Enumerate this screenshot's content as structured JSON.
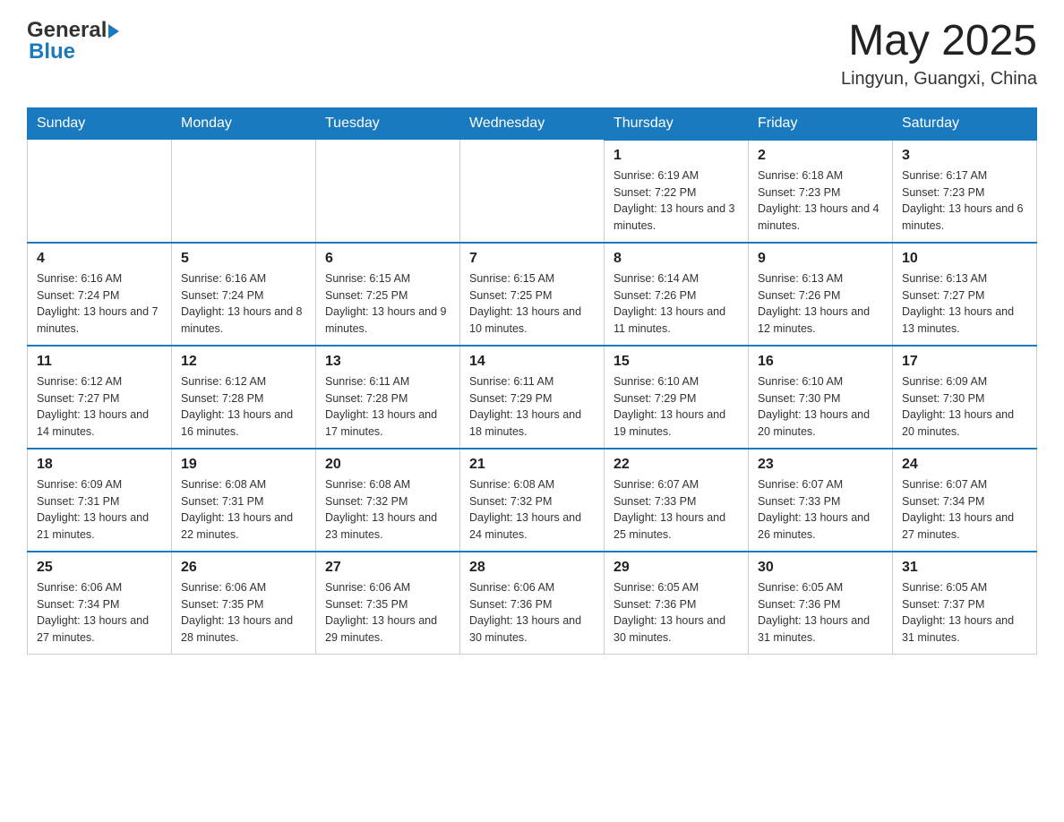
{
  "header": {
    "month_year": "May 2025",
    "location": "Lingyun, Guangxi, China"
  },
  "logo": {
    "general": "General",
    "blue": "Blue"
  },
  "days_of_week": [
    "Sunday",
    "Monday",
    "Tuesday",
    "Wednesday",
    "Thursday",
    "Friday",
    "Saturday"
  ],
  "weeks": [
    [
      {
        "day": "",
        "sunrise": "",
        "sunset": "",
        "daylight": ""
      },
      {
        "day": "",
        "sunrise": "",
        "sunset": "",
        "daylight": ""
      },
      {
        "day": "",
        "sunrise": "",
        "sunset": "",
        "daylight": ""
      },
      {
        "day": "",
        "sunrise": "",
        "sunset": "",
        "daylight": ""
      },
      {
        "day": "1",
        "sunrise": "Sunrise: 6:19 AM",
        "sunset": "Sunset: 7:22 PM",
        "daylight": "Daylight: 13 hours and 3 minutes."
      },
      {
        "day": "2",
        "sunrise": "Sunrise: 6:18 AM",
        "sunset": "Sunset: 7:23 PM",
        "daylight": "Daylight: 13 hours and 4 minutes."
      },
      {
        "day": "3",
        "sunrise": "Sunrise: 6:17 AM",
        "sunset": "Sunset: 7:23 PM",
        "daylight": "Daylight: 13 hours and 6 minutes."
      }
    ],
    [
      {
        "day": "4",
        "sunrise": "Sunrise: 6:16 AM",
        "sunset": "Sunset: 7:24 PM",
        "daylight": "Daylight: 13 hours and 7 minutes."
      },
      {
        "day": "5",
        "sunrise": "Sunrise: 6:16 AM",
        "sunset": "Sunset: 7:24 PM",
        "daylight": "Daylight: 13 hours and 8 minutes."
      },
      {
        "day": "6",
        "sunrise": "Sunrise: 6:15 AM",
        "sunset": "Sunset: 7:25 PM",
        "daylight": "Daylight: 13 hours and 9 minutes."
      },
      {
        "day": "7",
        "sunrise": "Sunrise: 6:15 AM",
        "sunset": "Sunset: 7:25 PM",
        "daylight": "Daylight: 13 hours and 10 minutes."
      },
      {
        "day": "8",
        "sunrise": "Sunrise: 6:14 AM",
        "sunset": "Sunset: 7:26 PM",
        "daylight": "Daylight: 13 hours and 11 minutes."
      },
      {
        "day": "9",
        "sunrise": "Sunrise: 6:13 AM",
        "sunset": "Sunset: 7:26 PM",
        "daylight": "Daylight: 13 hours and 12 minutes."
      },
      {
        "day": "10",
        "sunrise": "Sunrise: 6:13 AM",
        "sunset": "Sunset: 7:27 PM",
        "daylight": "Daylight: 13 hours and 13 minutes."
      }
    ],
    [
      {
        "day": "11",
        "sunrise": "Sunrise: 6:12 AM",
        "sunset": "Sunset: 7:27 PM",
        "daylight": "Daylight: 13 hours and 14 minutes."
      },
      {
        "day": "12",
        "sunrise": "Sunrise: 6:12 AM",
        "sunset": "Sunset: 7:28 PM",
        "daylight": "Daylight: 13 hours and 16 minutes."
      },
      {
        "day": "13",
        "sunrise": "Sunrise: 6:11 AM",
        "sunset": "Sunset: 7:28 PM",
        "daylight": "Daylight: 13 hours and 17 minutes."
      },
      {
        "day": "14",
        "sunrise": "Sunrise: 6:11 AM",
        "sunset": "Sunset: 7:29 PM",
        "daylight": "Daylight: 13 hours and 18 minutes."
      },
      {
        "day": "15",
        "sunrise": "Sunrise: 6:10 AM",
        "sunset": "Sunset: 7:29 PM",
        "daylight": "Daylight: 13 hours and 19 minutes."
      },
      {
        "day": "16",
        "sunrise": "Sunrise: 6:10 AM",
        "sunset": "Sunset: 7:30 PM",
        "daylight": "Daylight: 13 hours and 20 minutes."
      },
      {
        "day": "17",
        "sunrise": "Sunrise: 6:09 AM",
        "sunset": "Sunset: 7:30 PM",
        "daylight": "Daylight: 13 hours and 20 minutes."
      }
    ],
    [
      {
        "day": "18",
        "sunrise": "Sunrise: 6:09 AM",
        "sunset": "Sunset: 7:31 PM",
        "daylight": "Daylight: 13 hours and 21 minutes."
      },
      {
        "day": "19",
        "sunrise": "Sunrise: 6:08 AM",
        "sunset": "Sunset: 7:31 PM",
        "daylight": "Daylight: 13 hours and 22 minutes."
      },
      {
        "day": "20",
        "sunrise": "Sunrise: 6:08 AM",
        "sunset": "Sunset: 7:32 PM",
        "daylight": "Daylight: 13 hours and 23 minutes."
      },
      {
        "day": "21",
        "sunrise": "Sunrise: 6:08 AM",
        "sunset": "Sunset: 7:32 PM",
        "daylight": "Daylight: 13 hours and 24 minutes."
      },
      {
        "day": "22",
        "sunrise": "Sunrise: 6:07 AM",
        "sunset": "Sunset: 7:33 PM",
        "daylight": "Daylight: 13 hours and 25 minutes."
      },
      {
        "day": "23",
        "sunrise": "Sunrise: 6:07 AM",
        "sunset": "Sunset: 7:33 PM",
        "daylight": "Daylight: 13 hours and 26 minutes."
      },
      {
        "day": "24",
        "sunrise": "Sunrise: 6:07 AM",
        "sunset": "Sunset: 7:34 PM",
        "daylight": "Daylight: 13 hours and 27 minutes."
      }
    ],
    [
      {
        "day": "25",
        "sunrise": "Sunrise: 6:06 AM",
        "sunset": "Sunset: 7:34 PM",
        "daylight": "Daylight: 13 hours and 27 minutes."
      },
      {
        "day": "26",
        "sunrise": "Sunrise: 6:06 AM",
        "sunset": "Sunset: 7:35 PM",
        "daylight": "Daylight: 13 hours and 28 minutes."
      },
      {
        "day": "27",
        "sunrise": "Sunrise: 6:06 AM",
        "sunset": "Sunset: 7:35 PM",
        "daylight": "Daylight: 13 hours and 29 minutes."
      },
      {
        "day": "28",
        "sunrise": "Sunrise: 6:06 AM",
        "sunset": "Sunset: 7:36 PM",
        "daylight": "Daylight: 13 hours and 30 minutes."
      },
      {
        "day": "29",
        "sunrise": "Sunrise: 6:05 AM",
        "sunset": "Sunset: 7:36 PM",
        "daylight": "Daylight: 13 hours and 30 minutes."
      },
      {
        "day": "30",
        "sunrise": "Sunrise: 6:05 AM",
        "sunset": "Sunset: 7:36 PM",
        "daylight": "Daylight: 13 hours and 31 minutes."
      },
      {
        "day": "31",
        "sunrise": "Sunrise: 6:05 AM",
        "sunset": "Sunset: 7:37 PM",
        "daylight": "Daylight: 13 hours and 31 minutes."
      }
    ]
  ]
}
